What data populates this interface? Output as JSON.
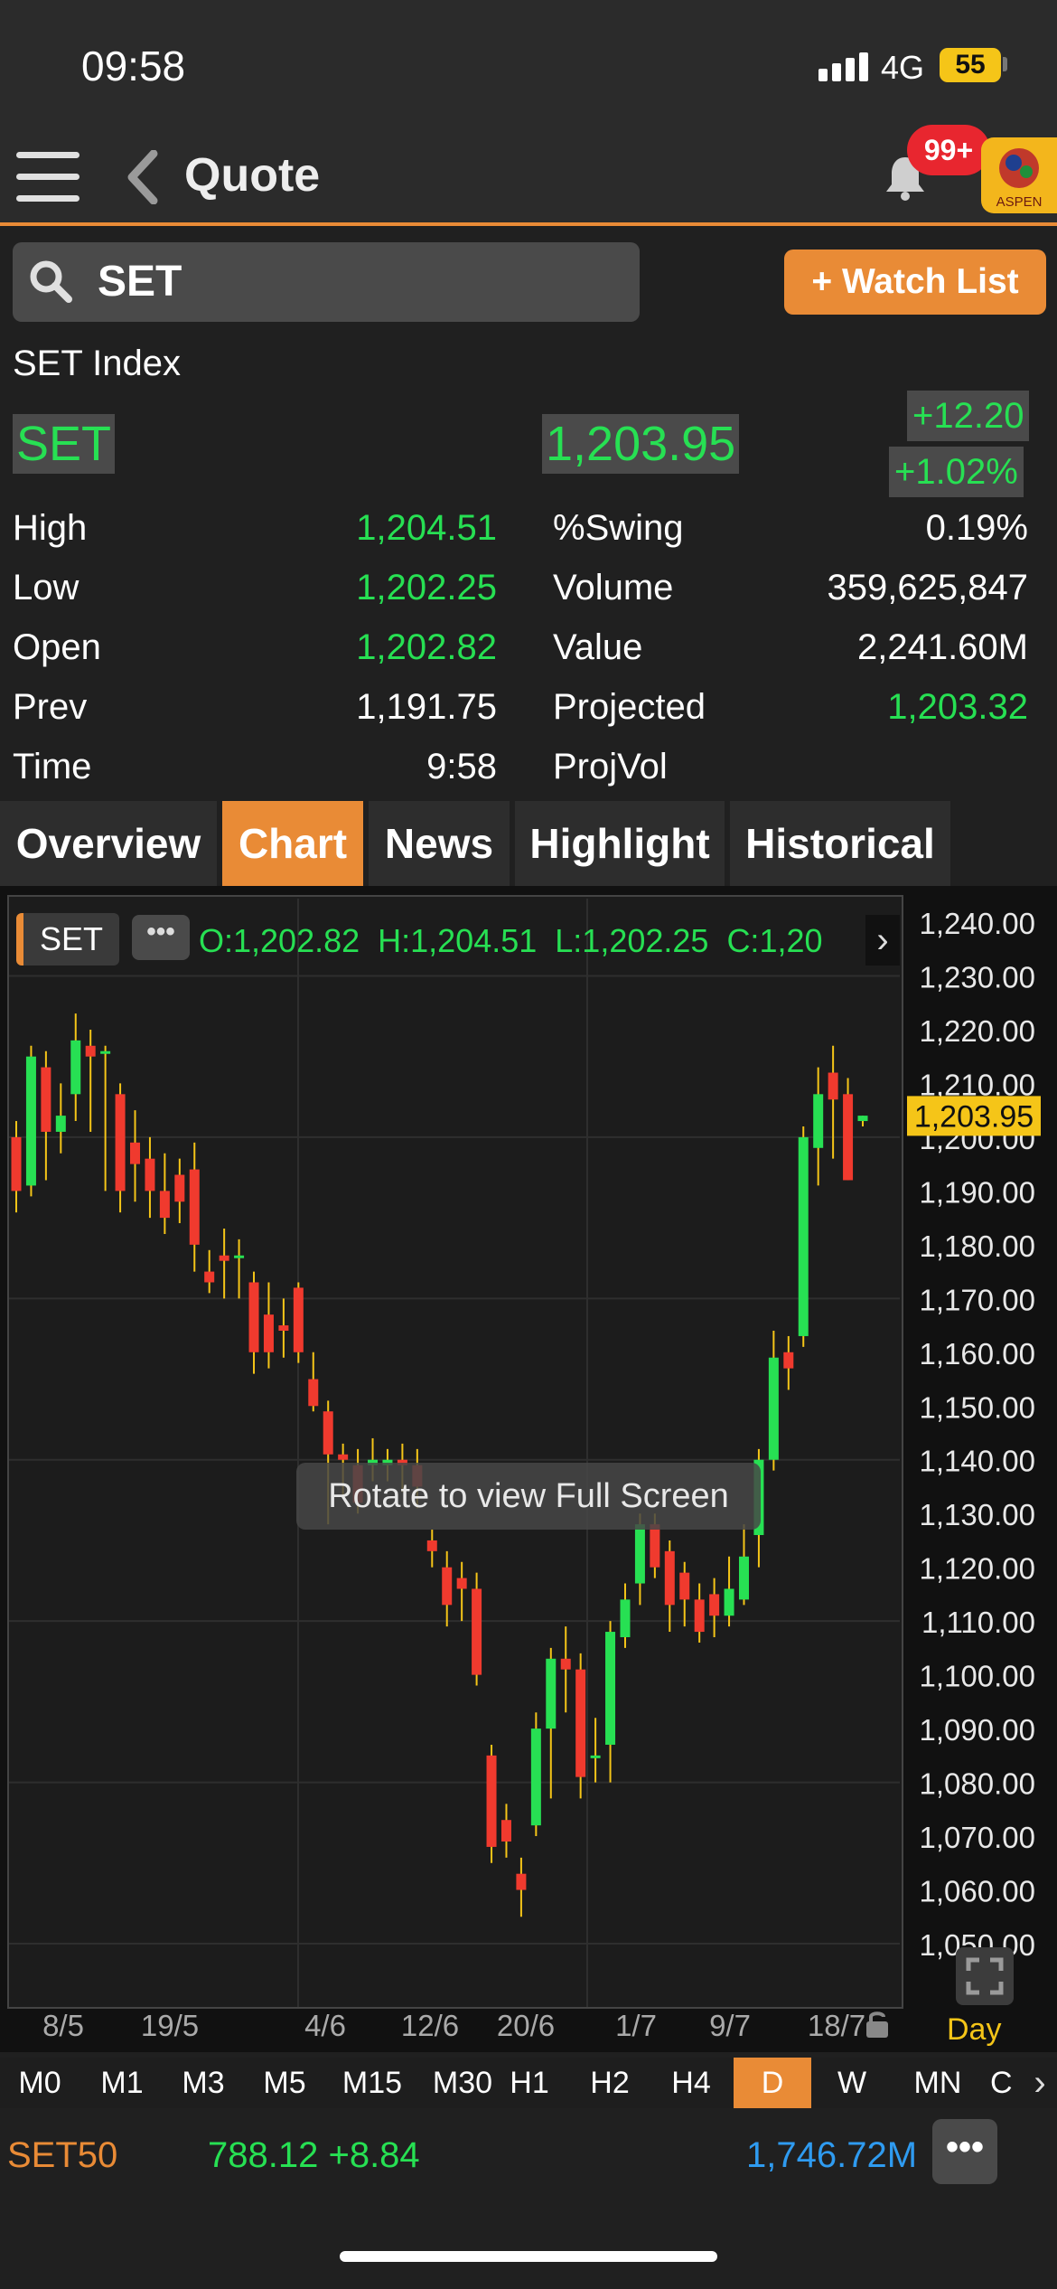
{
  "status": {
    "time": "09:58",
    "network": "4G",
    "battery": "55"
  },
  "nav": {
    "title": "Quote",
    "badge": "99+",
    "logo_text": "ASPEN"
  },
  "search": {
    "value": "SET",
    "watch_label": "+ Watch List"
  },
  "quote": {
    "name": "SET Index",
    "symbol": "SET",
    "last": "1,203.95",
    "change": "+12.20",
    "change_pct": "+1.02%"
  },
  "stats": {
    "high_label": "High",
    "high": "1,204.51",
    "low_label": "Low",
    "low": "1,202.25",
    "open_label": "Open",
    "open": "1,202.82",
    "prev_label": "Prev",
    "prev": "1,191.75",
    "time_label": "Time",
    "time": "9:58",
    "swing_label": "%Swing",
    "swing": "0.19%",
    "volume_label": "Volume",
    "volume": "359,625,847",
    "value_label": "Value",
    "value": "2,241.60M",
    "projected_label": "Projected",
    "projected": "1,203.32",
    "projvol_label": "ProjVol"
  },
  "tabs": [
    "Overview",
    "Chart",
    "News",
    "Highlight",
    "Historical"
  ],
  "active_tab": "Chart",
  "chart_header": {
    "symbol": "SET",
    "ohlc": "O:1,202.82  H:1,204.51  L:1,202.25  C:1,20"
  },
  "toast": "Rotate to view Full Screen",
  "period_label": "Day",
  "timeframes": [
    "M0",
    "M1",
    "M3",
    "M5",
    "M15",
    "M30",
    "H1",
    "H2",
    "H4",
    "D",
    "W",
    "MN",
    "C"
  ],
  "active_timeframe": "D",
  "ticker": {
    "symbol": "SET50",
    "value": "788.12 +8.84",
    "volume": "1,746.72M"
  },
  "colors": {
    "up": "#27e053",
    "down": "#f03a2e",
    "accent": "#e98b36",
    "price_tag": "#f5c518"
  },
  "chart_data": {
    "type": "candlestick",
    "ylim": [
      1050,
      1240
    ],
    "y_ticks": [
      "1,240.00",
      "1,230.00",
      "1,220.00",
      "1,210.00",
      "1,200.00",
      "1,190.00",
      "1,180.00",
      "1,170.00",
      "1,160.00",
      "1,150.00",
      "1,140.00",
      "1,130.00",
      "1,120.00",
      "1,110.00",
      "1,100.00",
      "1,090.00",
      "1,080.00",
      "1,070.00",
      "1,060.00",
      "1,050.00"
    ],
    "x_labels": [
      "8/5",
      "19/5",
      "4/6",
      "12/6",
      "20/6",
      "1/7",
      "9/7",
      "18/7"
    ],
    "last_price": "1,203.95",
    "candles": [
      [
        1200,
        1190,
        1203,
        1186
      ],
      [
        1191,
        1215,
        1217,
        1189
      ],
      [
        1213,
        1201,
        1216,
        1192
      ],
      [
        1201,
        1204,
        1210,
        1197
      ],
      [
        1208,
        1218,
        1223,
        1203
      ],
      [
        1217,
        1215,
        1220,
        1201
      ],
      [
        1216,
        1216,
        1217,
        1190
      ],
      [
        1208,
        1190,
        1210,
        1186
      ],
      [
        1199,
        1195,
        1205,
        1188
      ],
      [
        1196,
        1190,
        1200,
        1185
      ],
      [
        1190,
        1185,
        1197,
        1182
      ],
      [
        1193,
        1188,
        1196,
        1184
      ],
      [
        1194,
        1180,
        1199,
        1175
      ],
      [
        1175,
        1173,
        1179,
        1171
      ],
      [
        1178,
        1177,
        1183,
        1170
      ],
      [
        1178,
        1178,
        1181,
        1170
      ],
      [
        1173,
        1160,
        1175,
        1156
      ],
      [
        1167,
        1160,
        1173,
        1157
      ],
      [
        1165,
        1164,
        1170,
        1159
      ],
      [
        1172,
        1160,
        1173,
        1158
      ],
      [
        1155,
        1150,
        1160,
        1149
      ],
      [
        1149,
        1141,
        1151,
        1128
      ],
      [
        1141,
        1140,
        1143,
        1133
      ],
      [
        1139,
        1132,
        1142,
        1130
      ],
      [
        1139,
        1140,
        1144,
        1136
      ],
      [
        1139,
        1140,
        1142,
        1136
      ],
      [
        1140,
        1139,
        1143,
        1134
      ],
      [
        1139,
        1135,
        1142,
        1131
      ],
      [
        1125,
        1123,
        1127,
        1120
      ],
      [
        1120,
        1113,
        1123,
        1109
      ],
      [
        1118,
        1116,
        1121,
        1110
      ],
      [
        1116,
        1100,
        1119,
        1098
      ],
      [
        1085,
        1068,
        1087,
        1065
      ],
      [
        1073,
        1069,
        1076,
        1066
      ],
      [
        1063,
        1060,
        1066,
        1055
      ],
      [
        1072,
        1090,
        1093,
        1070
      ],
      [
        1090,
        1103,
        1105,
        1077
      ],
      [
        1103,
        1101,
        1109,
        1093
      ],
      [
        1101,
        1081,
        1104,
        1077
      ],
      [
        1085,
        1085,
        1092,
        1080
      ],
      [
        1087,
        1108,
        1110,
        1080
      ],
      [
        1107,
        1114,
        1117,
        1105
      ],
      [
        1117,
        1128,
        1130,
        1113
      ],
      [
        1128,
        1120,
        1130,
        1118
      ],
      [
        1123,
        1113,
        1125,
        1108
      ],
      [
        1119,
        1114,
        1121,
        1109
      ],
      [
        1114,
        1108,
        1117,
        1106
      ],
      [
        1115,
        1111,
        1118,
        1107
      ],
      [
        1111,
        1116,
        1122,
        1109
      ],
      [
        1114,
        1122,
        1128,
        1113
      ],
      [
        1126,
        1140,
        1142,
        1120
      ],
      [
        1140,
        1159,
        1164,
        1138
      ],
      [
        1160,
        1157,
        1163,
        1153
      ],
      [
        1163,
        1200,
        1202,
        1161
      ],
      [
        1198,
        1208,
        1213,
        1191
      ],
      [
        1212,
        1207,
        1217,
        1196
      ],
      [
        1208,
        1192,
        1211,
        1192
      ],
      [
        1203,
        1204,
        1204,
        1202
      ]
    ]
  }
}
